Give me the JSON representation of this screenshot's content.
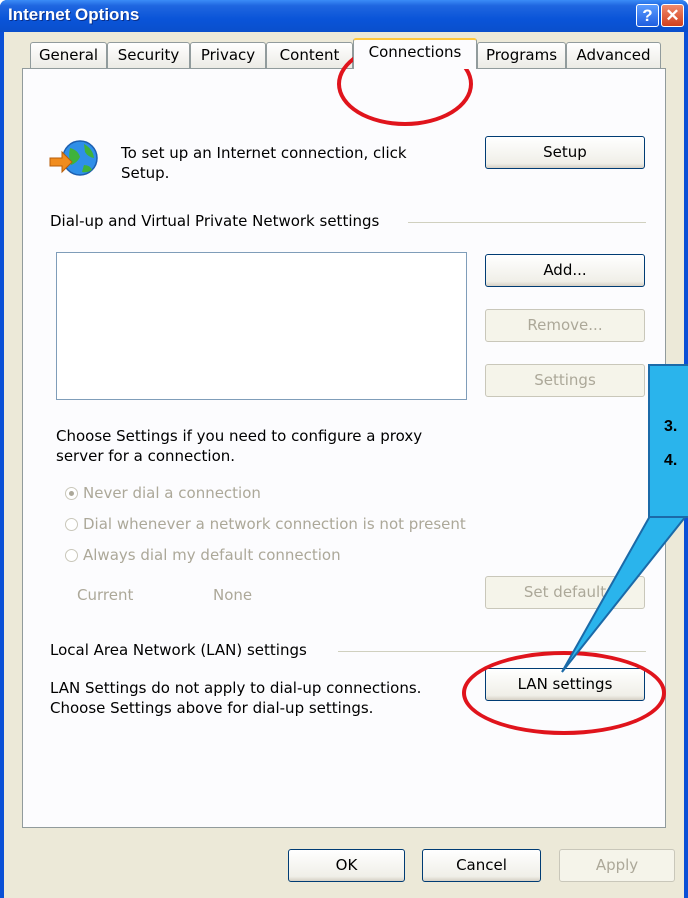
{
  "window": {
    "title": "Internet Options"
  },
  "title_buttons": {
    "help": "?",
    "close": "✕"
  },
  "tabs": [
    {
      "label": "General"
    },
    {
      "label": "Security"
    },
    {
      "label": "Privacy"
    },
    {
      "label": "Content"
    },
    {
      "label": "Connections",
      "active": true
    },
    {
      "label": "Programs"
    },
    {
      "label": "Advanced"
    }
  ],
  "setup": {
    "text_line1": "To set up an Internet connection, click",
    "text_line2": "Setup.",
    "button": "Setup",
    "icon": "globe-connection-icon"
  },
  "dialup": {
    "heading": "Dial-up and Virtual Private Network settings",
    "add": "Add...",
    "remove": "Remove...",
    "settings": "Settings",
    "choose_line1": "Choose Settings if you need to configure a proxy",
    "choose_line2": "server for a connection.",
    "options": [
      {
        "label": "Never dial a connection",
        "selected": true
      },
      {
        "label": "Dial whenever a network connection is not present",
        "selected": false
      },
      {
        "label": "Always dial my default connection",
        "selected": false
      }
    ],
    "current_label": "Current",
    "current_value": "None",
    "set_default": "Set default"
  },
  "lan": {
    "heading": "Local Area Network (LAN) settings",
    "text_line1": "LAN Settings do not apply to dial-up connections.",
    "text_line2": "Choose Settings above for dial-up settings.",
    "button": "LAN settings"
  },
  "footer": {
    "ok": "OK",
    "cancel": "Cancel",
    "apply": "Apply"
  },
  "callout": {
    "step3": "3.",
    "step4": "4."
  },
  "colors": {
    "highlight_oval": "#e0141c",
    "callout_fill": "#2ab4ec",
    "title_blue": "#0a54d8"
  }
}
